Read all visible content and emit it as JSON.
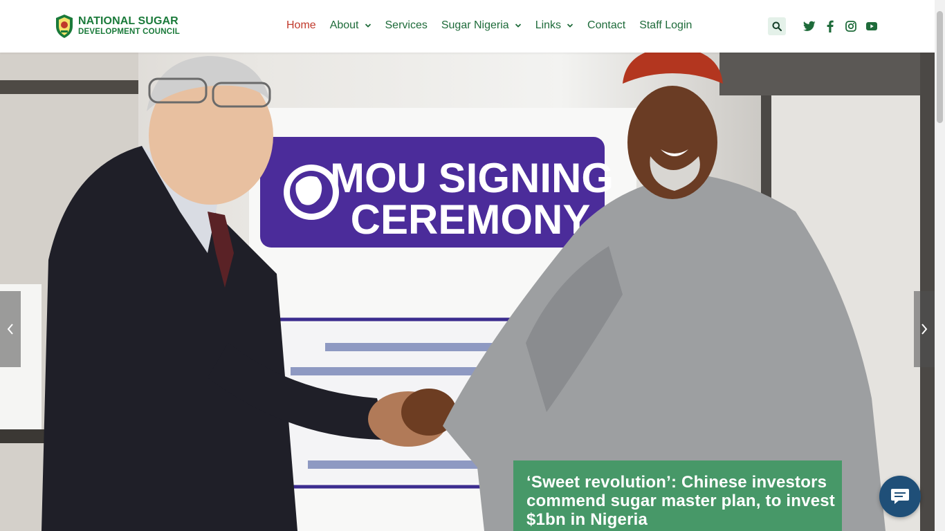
{
  "brand": {
    "line1": "NATIONAL SUGAR",
    "line2": "DEVELOPMENT COUNCIL",
    "color": "#1a7a3a"
  },
  "nav": {
    "items": [
      {
        "label": "Home",
        "active": true,
        "dropdown": false
      },
      {
        "label": "About",
        "active": false,
        "dropdown": true
      },
      {
        "label": "Services",
        "active": false,
        "dropdown": false
      },
      {
        "label": "Sugar Nigeria",
        "active": false,
        "dropdown": true
      },
      {
        "label": "Links",
        "active": false,
        "dropdown": true
      },
      {
        "label": "Contact",
        "active": false,
        "dropdown": false
      },
      {
        "label": "Staff Login",
        "active": false,
        "dropdown": false
      }
    ],
    "active_color": "#c0392b",
    "link_color": "#1e6b3a"
  },
  "header_icons": [
    "search-icon",
    "twitter-icon",
    "facebook-icon",
    "instagram-icon",
    "youtube-icon"
  ],
  "hero": {
    "banner_line1": "MOU SIGNING",
    "banner_line2": "CEREMONY",
    "caption": "‘Sweet revolution’: Chinese investors commend sugar master plan, to invest $1bn in Nigeria",
    "caption_bg": "#34965c"
  },
  "slider": {
    "prev_icon": "chevron-left-icon",
    "next_icon": "chevron-right-icon"
  },
  "chat": {
    "icon": "chat-icon",
    "color": "#1f4f78"
  }
}
